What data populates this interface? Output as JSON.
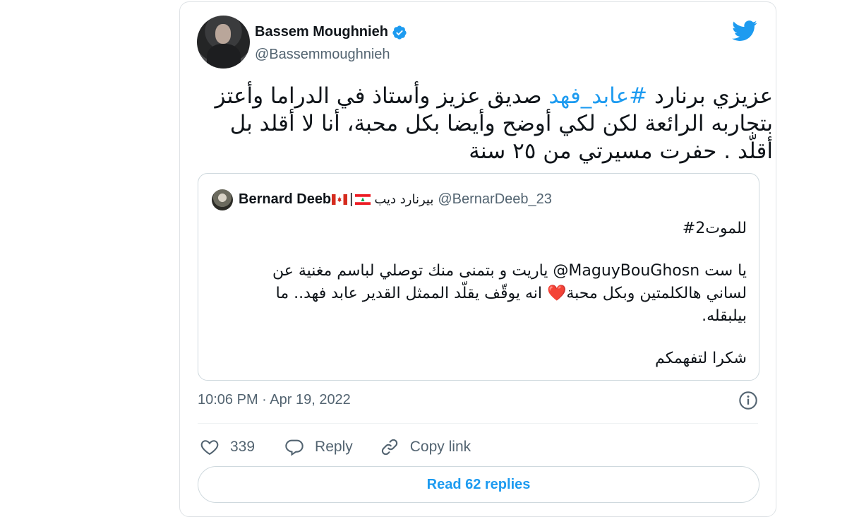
{
  "author": {
    "name": "Bassem Moughnieh",
    "handle": "@Bassemmoughnieh",
    "verified": true,
    "avatar_icon": "profile-photo"
  },
  "tweet": {
    "text_before_hashtag": "عزيزي برنارد",
    "hashtag": "#عابد_فهد",
    "text_after_hashtag": "صديق عزيز وأستاذ في الدراما وأعتز بتجاربه الرائعة لكن لكي أوضح وأيضا بكل محبة، أنا لا أقلد بل أقلّد . حفرت مسيرتي من ٢٥ سنة"
  },
  "quoted_tweet": {
    "name": "Bernard Deeb",
    "name_arabic": "بيرنارد ديب",
    "separator": "|",
    "handle": "@BernarDeeb_23",
    "lines": [
      "للموت2#",
      "",
      "يا ست MaguyBouGhosn@ ياريت و بتمنى منك توصلي لباسم مغنية عن",
      "لساني هالكلمتين وبكل محبة❤️ انه يوقّف يقلّد الممثل القدير عابد فهد.. ما",
      "بيلبقله.",
      "",
      "شكرا لتفهمكم"
    ]
  },
  "timestamp": "10:06 PM · Apr 19, 2022",
  "actions": {
    "likes": "339",
    "reply_label": "Reply",
    "copy_link_label": "Copy link"
  },
  "read_replies_label": "Read 62 replies",
  "colors": {
    "brand": "#1d9bf0",
    "text": "#0f1419",
    "muted": "#536471",
    "border": "#cfd9de"
  }
}
